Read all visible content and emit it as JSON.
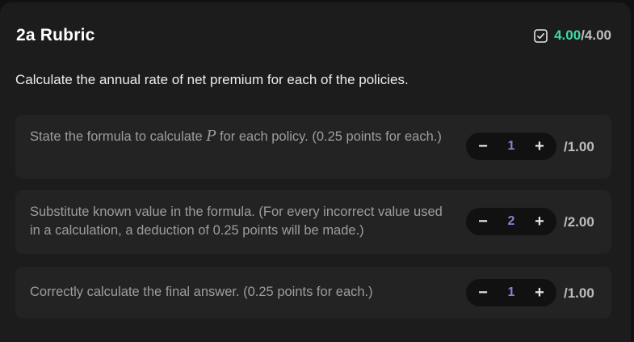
{
  "rubric": {
    "title": "2a Rubric",
    "score_earned": "4.00",
    "score_total": "/4.00",
    "score_color": "#3fd9a6",
    "score_icon": "checkbox-checked-icon"
  },
  "question": "Calculate the annual rate of net premium for each of the policies.",
  "criteria": [
    {
      "text_before": "State the formula to calculate ",
      "math": "P",
      "text_after": " for each policy. (0.25 points for each.)",
      "value": "1",
      "max": "/1.00"
    },
    {
      "text": "Substitute known value in the formula. (For every incorrect value used in a calculation, a deduction of 0.25 points will be made.)",
      "value": "2",
      "max": "/2.00"
    },
    {
      "text": "Correctly calculate the final answer. (0.25 points for each.)",
      "value": "1",
      "max": "/1.00"
    }
  ],
  "stepper": {
    "minus_label": "−",
    "plus_label": "+",
    "value_color": "#8f7fcf"
  }
}
